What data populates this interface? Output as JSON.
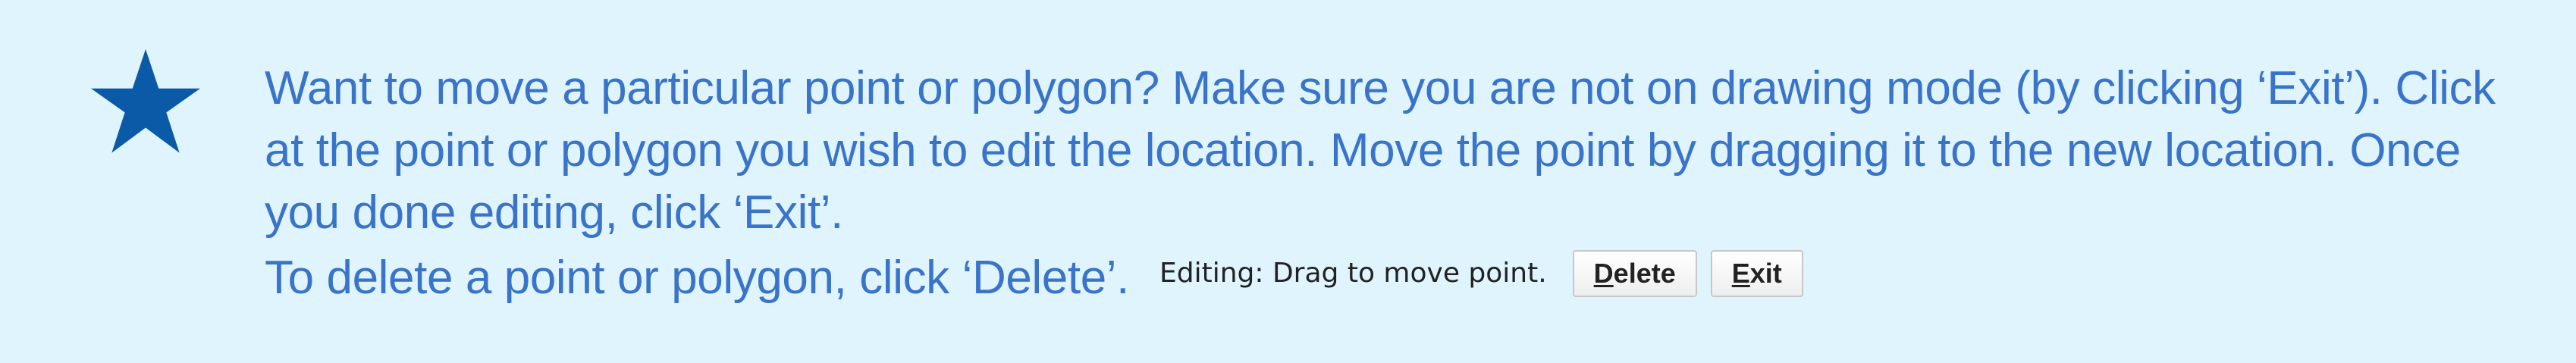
{
  "colors": {
    "background": "#dff4fd",
    "instruction_text": "#3a74c9",
    "star": "#0a5aa8",
    "status_text": "#222222"
  },
  "tip": {
    "icon": "star-icon",
    "paragraph": "Want to move a particular point or polygon? Make sure you are not on drawing mode (by clicking ‘Exit’).  Click at the point or polygon you wish to edit the location. Move the point by dragging it to the new location. Once you done editing, click ‘Exit’.",
    "delete_instruction": "To delete a point or polygon, click ‘Delete’."
  },
  "editor_toolbar": {
    "status": "Editing: Drag to move point.",
    "delete_button": {
      "accel": "D",
      "rest": "elete"
    },
    "exit_button": {
      "accel": "E",
      "rest": "xit"
    }
  }
}
